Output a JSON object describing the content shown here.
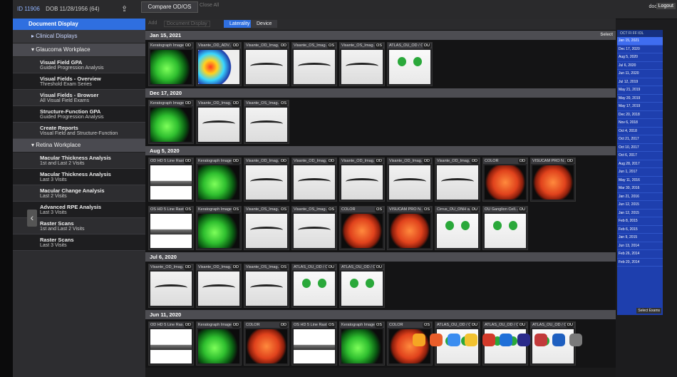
{
  "header": {
    "id": "ID 11906",
    "dob": "DOB 11/28/1956 (64)",
    "compare_label": "Compare OD/OS",
    "toolbar_items": [
      "Close All"
    ],
    "user": "doctor",
    "logout": "Logout"
  },
  "sidebar": {
    "header": "Document Display",
    "clinical": "Clinical Displays",
    "glaucoma": "Glaucoma Workplace",
    "glaucoma_items": [
      {
        "title": "Visual Field GPA",
        "sub": "Guided Progression Analysis"
      },
      {
        "title": "Visual Fields - Overview",
        "sub": "Threshold Exam Series"
      },
      {
        "title": "Visual Fields - Browser",
        "sub": "All Visual Field Exams"
      },
      {
        "title": "Structure-Function GPA",
        "sub": "Guided Progression Analysis"
      },
      {
        "title": "Create Reports",
        "sub": "Visual Field and Structure-Function"
      }
    ],
    "retina": "Retina Workplace",
    "retina_items": [
      {
        "title": "Macular Thickness Analysis",
        "sub": "1st and Last 2 Visits"
      },
      {
        "title": "Macular Thickness Analysis",
        "sub": "Last 3 Visits"
      },
      {
        "title": "Macular Change Analysis",
        "sub": "Last 2 Visits"
      },
      {
        "title": "Advanced RPE Analysis",
        "sub": "Last 3 Visits"
      },
      {
        "title": "Raster Scans",
        "sub": "1st and Last 2 Visits"
      },
      {
        "title": "Raster Scans",
        "sub": "Last 3 Visits"
      }
    ]
  },
  "subbar": {
    "add": "Add",
    "document_display": "Document Display",
    "laterality": "Laterality",
    "device": "Device"
  },
  "exams": [
    {
      "date": "Jan 15, 2021",
      "select": "Select",
      "thumbs": [
        {
          "label": "Keratograph Image",
          "eye": "OD",
          "img": "kerato"
        },
        {
          "label": "Visante_OD_ADV...",
          "eye": "OD",
          "img": "adv"
        },
        {
          "label": "Visante_OD_Imag...",
          "eye": "OD",
          "img": "visante"
        },
        {
          "label": "Visante_OS_Imag...",
          "eye": "OS",
          "img": "visante"
        },
        {
          "label": "Visante_OS_Imag...",
          "eye": "OS",
          "img": "visante"
        },
        {
          "label": "ATLAS_OU_OD / OS",
          "eye": "OU",
          "img": "atlas"
        }
      ]
    },
    {
      "date": "Dec 17, 2020",
      "select": "",
      "thumbs": [
        {
          "label": "Keratograph Image",
          "eye": "OD",
          "img": "kerato"
        },
        {
          "label": "Visante_OD_Imag...",
          "eye": "OD",
          "img": "visante"
        },
        {
          "label": "Visante_OS_Imag...",
          "eye": "OS",
          "img": "visante"
        }
      ]
    },
    {
      "date": "Aug 5, 2020",
      "select": "",
      "thumbs": [
        {
          "label": "OD HD 5 Line Rast...",
          "eye": "OD",
          "img": "raster"
        },
        {
          "label": "Keratograph Image",
          "eye": "OD",
          "img": "kerato"
        },
        {
          "label": "Visante_OD_Imag...",
          "eye": "OD",
          "img": "visante"
        },
        {
          "label": "Visante_OD_Imag...",
          "eye": "OD",
          "img": "visante"
        },
        {
          "label": "Visante_OD_Imag...",
          "eye": "OD",
          "img": "visante"
        },
        {
          "label": "Visante_OD_Imag...",
          "eye": "OD",
          "img": "visante"
        },
        {
          "label": "Visante_OD_Imag...",
          "eye": "OD",
          "img": "visante"
        },
        {
          "label": "COLOR",
          "eye": "OD",
          "img": "color"
        },
        {
          "label": "VISUCAM PRO N...",
          "eye": "OD",
          "img": "color"
        }
      ],
      "thumbs2": [
        {
          "label": "OS HD 5 Line Raster",
          "eye": "OS",
          "img": "raster"
        },
        {
          "label": "Keratograph Image",
          "eye": "OS",
          "img": "kerato"
        },
        {
          "label": "Visante_OS_Imag...",
          "eye": "OS",
          "img": "visante"
        },
        {
          "label": "Visante_OS_Imag...",
          "eye": "OS",
          "img": "visante"
        },
        {
          "label": "COLOR",
          "eye": "OS",
          "img": "color"
        },
        {
          "label": "VISUCAM PRO N...",
          "eye": "OS",
          "img": "color"
        },
        {
          "label": "Cirrus_OU_ONH a...",
          "eye": "OU",
          "img": "atlas"
        },
        {
          "label": "OU Ganglion Cell...",
          "eye": "OU",
          "img": "atlas"
        }
      ]
    },
    {
      "date": "Jul 6, 2020",
      "select": "",
      "thumbs": [
        {
          "label": "Visante_OD_Imag...",
          "eye": "OD",
          "img": "visante"
        },
        {
          "label": "Visante_OD_Imag...",
          "eye": "OD",
          "img": "visante"
        },
        {
          "label": "Visante_OS_Imag...",
          "eye": "OS",
          "img": "visante"
        },
        {
          "label": "ATLAS_OU_OD / OS",
          "eye": "OU",
          "img": "atlas"
        },
        {
          "label": "ATLAS_OU_OD / OS",
          "eye": "OU",
          "img": "atlas"
        }
      ]
    },
    {
      "date": "Jun 11, 2020",
      "select": "",
      "thumbs": [
        {
          "label": "OD HD 5 Line Ras...",
          "eye": "OD",
          "img": "raster"
        },
        {
          "label": "Keratograph Image",
          "eye": "OD",
          "img": "kerato"
        },
        {
          "label": "COLOR",
          "eye": "OD",
          "img": "color"
        },
        {
          "label": "OS HD 5 Line Raster",
          "eye": "OS",
          "img": "raster"
        },
        {
          "label": "Keratograph Image",
          "eye": "OS",
          "img": "kerato"
        },
        {
          "label": "COLOR",
          "eye": "OS",
          "img": "color"
        },
        {
          "label": "ATLAS_OU_OD / OS",
          "eye": "OU",
          "img": "atlas"
        },
        {
          "label": "ATLAS_OU_OD / OS",
          "eye": "OU",
          "img": "atlas"
        },
        {
          "label": "ATLAS_OU_OD / OS",
          "eye": "OU",
          "img": "atlas"
        }
      ]
    }
  ],
  "calendar": {
    "header": "OCT  FI  FF  IOL",
    "dates": [
      "Jan 15, 2021",
      "Dec 17, 2020",
      "Aug 5, 2020",
      "Jul 6, 2020",
      "Jun 11, 2020",
      "Jul 12, 2019",
      "May 21, 2019",
      "May 20, 2019",
      "May 17, 2019",
      "Dec 20, 2018",
      "Nov 6, 2018",
      "Oct 4, 2018",
      "Oct 21, 2017",
      "Oct 10, 2017",
      "Oct 6, 2017",
      "Aug 28, 2017",
      "Jun 1, 2017",
      "May 11, 2016",
      "Mar 30, 2016",
      "Jan 21, 2016",
      "Jun 12, 2015",
      "Jan 12, 2015",
      "Feb 8, 2015",
      "Feb 6, 2015",
      "Jan 9, 2015",
      "Jun 13, 2014",
      "Feb 26, 2014",
      "Feb 20, 2014"
    ],
    "footer": "Select Exams"
  },
  "colors": {
    "accent": "#2f6fe0",
    "calendar": "#1e3fae"
  }
}
